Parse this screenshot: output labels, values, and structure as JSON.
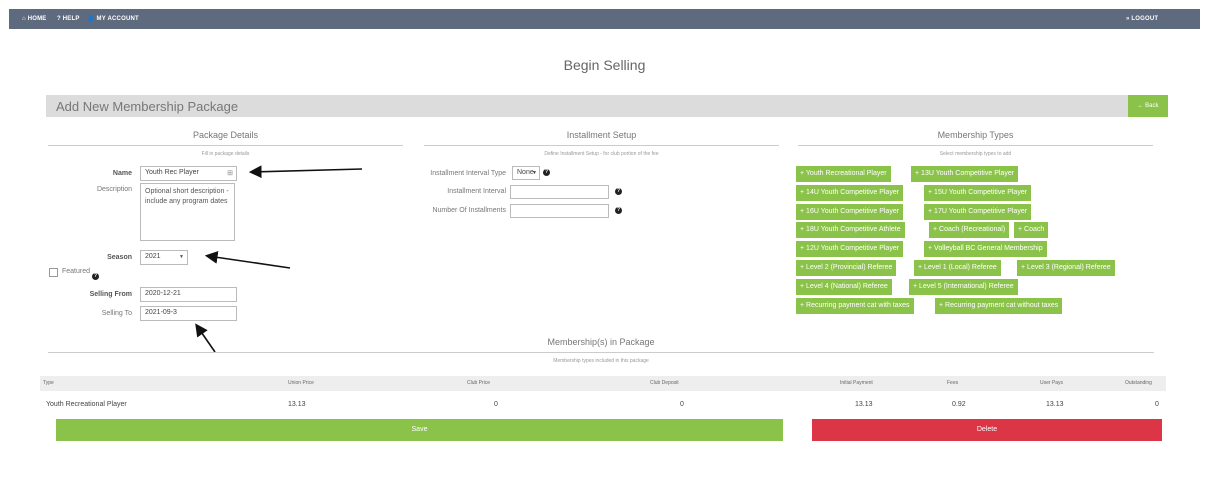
{
  "topbar": {
    "home": "⌂ HOME",
    "help": "? HELP",
    "account": "👤 MY ACCOUNT",
    "logout": "» LOGOUT"
  },
  "page_title": "Begin Selling",
  "header_bar": {
    "title": "Add New Membership Package",
    "back": "← Back"
  },
  "package_details": {
    "title": "Package Details",
    "subtitle": "Fill in package details",
    "name_label": "Name",
    "name_value": "Youth Rec Player",
    "description_label": "Description",
    "description_placeholder": "Optional short description - include any program dates",
    "season_label": "Season",
    "season_value": "2021",
    "featured_label": "Featured",
    "selling_from_label": "Selling From",
    "selling_from_value": "2020-12-21",
    "selling_to_label": "Selling To",
    "selling_to_value": "2021-09-3"
  },
  "installment": {
    "title": "Installment Setup",
    "subtitle": "Define Installment Setup - for club portion of the fee",
    "interval_type_label": "Installment Interval Type",
    "interval_type_value": "None",
    "interval_label": "Installment Interval",
    "count_label": "Number Of Installments"
  },
  "membership_types": {
    "title": "Membership Types",
    "subtitle": "Select membership types to add",
    "tags": [
      "Youth Recreational Player",
      "13U Youth Competitive Player",
      "14U Youth Competitive Player",
      "15U Youth Competitive Player",
      "16U Youth Competitive Player",
      "17U Youth Competitive Player",
      "18U Youth Competitive Athlete",
      "Coach (Recreational)",
      "Coach",
      "12U Youth Competitive Player",
      "Volleyball BC General Membership",
      "Level 2 (Provincial) Referee",
      "Level 1 (Local) Referee",
      "Level 3 (Regional) Referee",
      "Level 4 (National) Referee",
      "Level 5 (International) Referee",
      "Recurring payment cat with taxes",
      "Recurring payment cat without taxes"
    ]
  },
  "in_package": {
    "title": "Membership(s) in Package",
    "subtitle": "Membership types included in this package",
    "columns": [
      "Type",
      "Union Price",
      "Club Price",
      "Club Deposit",
      "Initial Payment",
      "Fees",
      "User Pays",
      "Outstanding"
    ],
    "row": [
      "Youth Recreational Player",
      "13.13",
      "0",
      "0",
      "13.13",
      "0.92",
      "13.13",
      "0"
    ]
  },
  "actions": {
    "save": "Save",
    "delete": "Delete"
  },
  "colors": {
    "topbar": "#5e6a7d",
    "green": "#8bc34a",
    "red": "#dc3545"
  }
}
